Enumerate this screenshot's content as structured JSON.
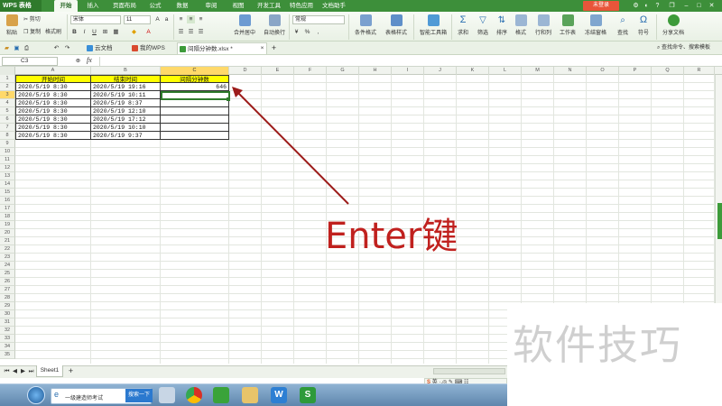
{
  "app": {
    "name": "WPS 表格",
    "login_label": "未登录"
  },
  "menu": [
    "开始",
    "插入",
    "页面布局",
    "公式",
    "数据",
    "审阅",
    "视图",
    "开发工具",
    "特色应用",
    "文档助手"
  ],
  "ribbon": {
    "paste": "粘贴",
    "cut": "剪切",
    "copy": "复制",
    "format_painter": "格式刷",
    "font_name": "宋体",
    "font_size": "11",
    "merge_center": "合并居中",
    "wrap_text": "自动换行",
    "number_format": "常规",
    "conditional_format": "条件格式",
    "table_style": "表格样式",
    "smart_toolbox": "智能工具箱",
    "sum": "求和",
    "filter": "筛选",
    "sort": "排序",
    "format": "格式",
    "row_col": "行和列",
    "worksheet": "工作表",
    "freeze": "冻结窗格",
    "find": "查找",
    "symbol": "符号",
    "share": "分享文档"
  },
  "tabs": [
    {
      "label": "云文档",
      "color": "#3a8fd8"
    },
    {
      "label": "我的WPS",
      "color": "#d94a2f"
    },
    {
      "label": "间隔分钟数.xlsx *",
      "color": "#3d9b3a"
    }
  ],
  "search_hint": "查找命令、搜索模板",
  "formula_bar": {
    "name_box": "C3",
    "fx": "fx"
  },
  "columns": [
    "A",
    "B",
    "C",
    "D",
    "E",
    "F",
    "G",
    "H",
    "I",
    "J",
    "K",
    "L",
    "M",
    "N",
    "O",
    "P",
    "Q",
    "R"
  ],
  "rows": [
    "1",
    "2",
    "3",
    "4",
    "5",
    "6",
    "7",
    "8",
    "9",
    "10",
    "11",
    "12",
    "13",
    "14",
    "15",
    "16",
    "17",
    "18",
    "19",
    "20",
    "21",
    "22",
    "23",
    "24",
    "25",
    "26",
    "27",
    "28",
    "29",
    "30",
    "31",
    "32",
    "33",
    "34",
    "35"
  ],
  "table": {
    "headers": [
      "开始时间",
      "结束时间",
      "间隔分钟数"
    ],
    "rows": [
      [
        "2020/5/19 8:30",
        "2020/5/19 19:16",
        "646"
      ],
      [
        "2020/5/19 8:30",
        "2020/5/19 10:11",
        ""
      ],
      [
        "2020/5/19 8:30",
        "2020/5/19 8:37",
        ""
      ],
      [
        "2020/5/19 8:30",
        "2020/5/19 12:10",
        ""
      ],
      [
        "2020/5/19 8:30",
        "2020/5/19 17:12",
        ""
      ],
      [
        "2020/5/19 8:30",
        "2020/5/19 10:10",
        ""
      ],
      [
        "2020/5/19 8:30",
        "2020/5/19 9:37",
        ""
      ]
    ]
  },
  "sheet_tab": "Sheet1",
  "annotation": "Enter键",
  "watermark": "软件技巧",
  "taskbar": {
    "search_placeholder": "一级建造师考试",
    "search_button": "搜索一下",
    "ime_label": "英"
  },
  "colors": {
    "brand": "#3d8f3a",
    "header_fill": "#ffff00",
    "annotation": "#c0211e"
  }
}
